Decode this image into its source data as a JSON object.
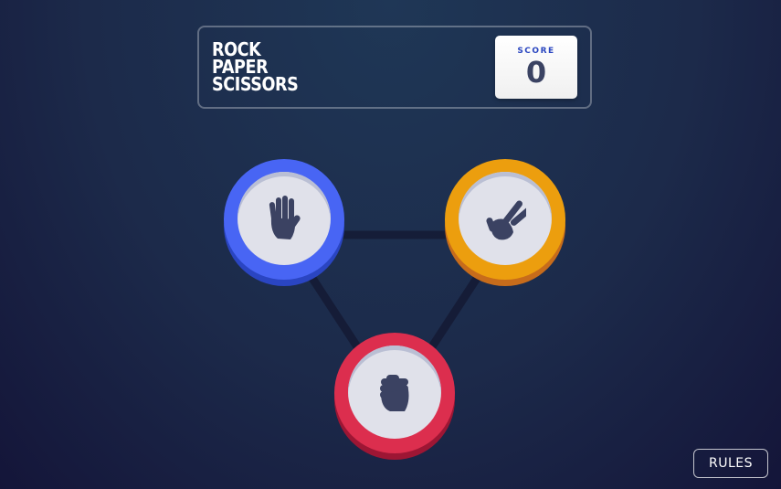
{
  "header": {
    "title_lines": [
      "ROCK",
      "PAPER",
      "SCISSORS"
    ],
    "score_label": "SCORE",
    "score_value": "0"
  },
  "tokens": [
    {
      "name": "paper",
      "icon": "paper-hand-icon",
      "color": "#4865f4"
    },
    {
      "name": "scissors",
      "icon": "scissors-hand-icon",
      "color": "#ec9e0e"
    },
    {
      "name": "rock",
      "icon": "rock-fist-icon",
      "color": "#dc2e4e"
    }
  ],
  "rules_button": {
    "label": "RULES"
  }
}
